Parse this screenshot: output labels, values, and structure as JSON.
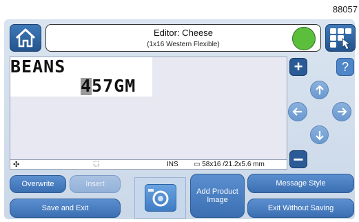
{
  "corner_id": "88057",
  "header": {
    "title": "Editor: Cheese",
    "subtitle": "(1x16 Western Flexible)",
    "status_color": "#5cbf3c"
  },
  "editor": {
    "line1": "BEANS",
    "line2": "457GM",
    "status": {
      "mode": "INS",
      "dimensions": "58x16 /21.2x5.6 mm"
    }
  },
  "controls": {
    "plus": "+",
    "help": "?",
    "minus": "−"
  },
  "buttons": {
    "overwrite": "Overwrite",
    "insert": "Insert",
    "save_exit": "Save and Exit",
    "add_product_image": "Add Product Image",
    "message_style": "Message Style",
    "exit_without_saving": "Exit Without Saving"
  },
  "icons": {
    "home": "home-icon",
    "grid": "grid-menu-icon",
    "camera": "camera-icon",
    "up": "arrow-up-icon",
    "down": "arrow-down-icon",
    "left": "arrow-left-icon",
    "right": "arrow-right-icon"
  }
}
